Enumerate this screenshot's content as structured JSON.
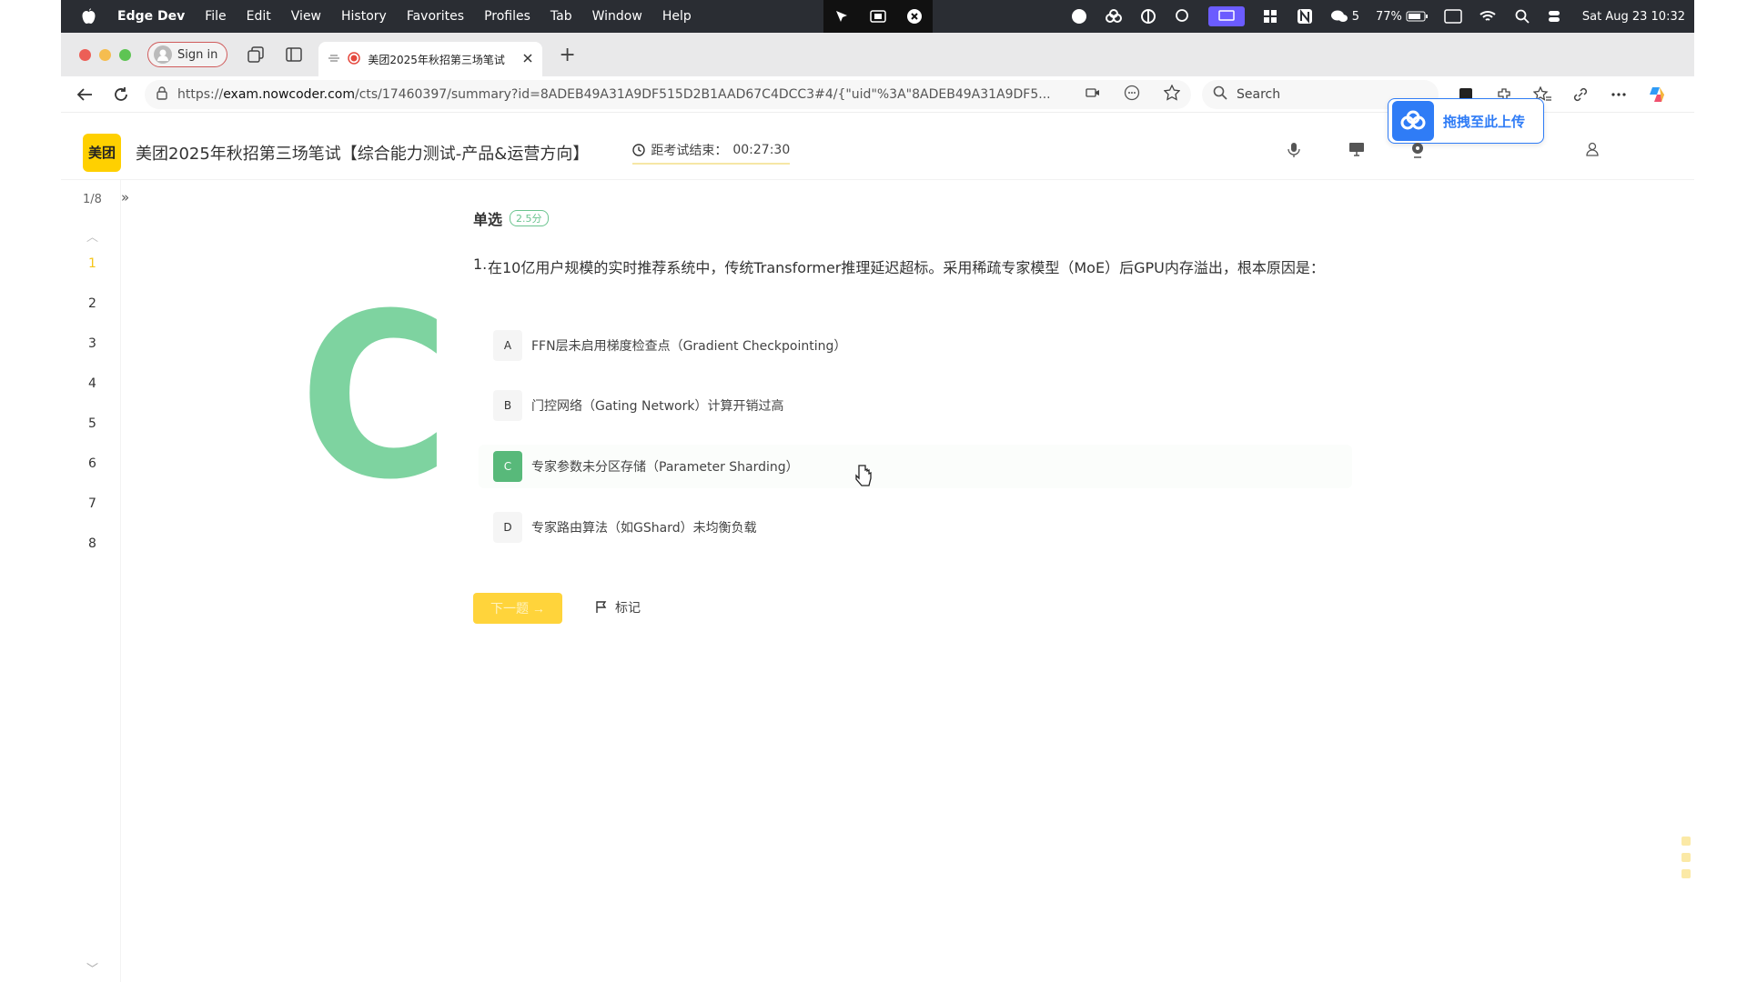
{
  "menubar": {
    "app": "Edge Dev",
    "items": [
      "File",
      "Edit",
      "View",
      "History",
      "Favorites",
      "Profiles",
      "Tab",
      "Window",
      "Help"
    ],
    "wechat_count": "5",
    "battery": "77%",
    "datetime": "Sat Aug 23  10:32"
  },
  "browser": {
    "signin_label": "Sign in",
    "tab_title": "美团2025年秋招第三场笔试",
    "url_prefix": "https://",
    "url_host": "exam.nowcoder.com",
    "url_rest": "/cts/17460397/summary?id=8ADEB49A31A9DF515D2B1AAD67C4DCC3#4/{\"uid\"%3A\"8ADEB49A31A9DF5...",
    "search_placeholder": "Search"
  },
  "upload": {
    "label": "拖拽至此上传"
  },
  "header": {
    "logo": "美团",
    "title": "美团2025年秋招第三场笔试【综合能力测试-产品&运营方向】",
    "timer_label": "距考试结束：",
    "timer_value": "00:27:30"
  },
  "qnav": {
    "count": "1/8",
    "numbers": [
      "1",
      "2",
      "3",
      "4",
      "5",
      "6",
      "7",
      "8"
    ],
    "active": "1"
  },
  "question": {
    "type": "单选",
    "points": "2.5分",
    "number": "1.",
    "text": "在10亿用户规模的实时推荐系统中，传统Transformer推理延迟超标。采用稀疏专家模型（MoE）后GPU内存溢出，根本原因是：",
    "options": [
      {
        "key": "A",
        "text": "FFN层未启用梯度检查点（Gradient Checkpointing）"
      },
      {
        "key": "B",
        "text": "门控网络（Gating Network）计算开销过高"
      },
      {
        "key": "C",
        "text": "专家参数未分区存储（Parameter Sharding）"
      },
      {
        "key": "D",
        "text": "专家路由算法（如GShard）未均衡负载"
      }
    ],
    "selected": "C",
    "overlay_letter": "C"
  },
  "actions": {
    "next_label": "下一题 →",
    "mark_label": "标记"
  },
  "colors": {
    "accent": "#ffd43b",
    "selected": "#58b97a",
    "link_blue": "#2f7cf6"
  }
}
